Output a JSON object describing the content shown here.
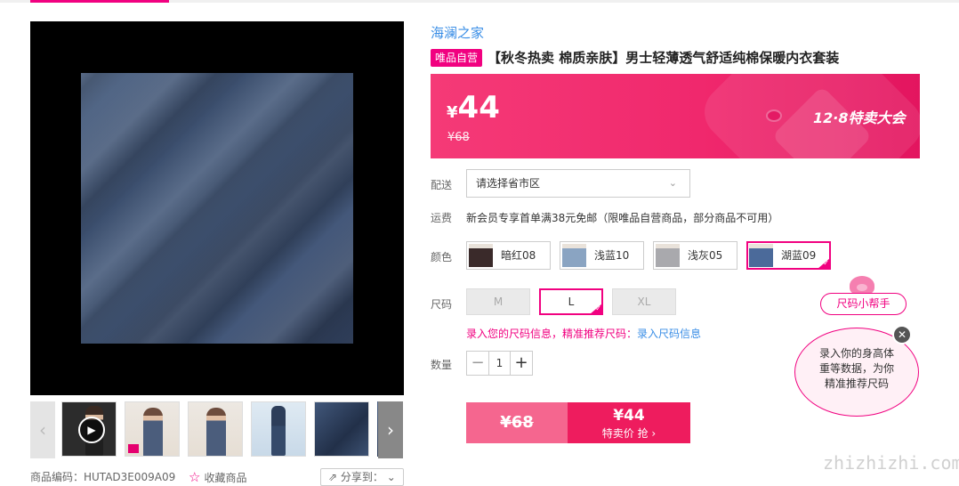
{
  "gallery": {
    "thumbnails": [
      "video",
      "model-front",
      "model-front-2",
      "model-full",
      "fabric",
      "fabric-detail"
    ]
  },
  "meta": {
    "product_code": "商品编码：HUTAD3E009A09",
    "favorite": "收藏商品",
    "share": "分享到："
  },
  "product": {
    "brand": "海澜之家",
    "vip_badge": "唯品自营",
    "title": "【秋冬热卖 棉质亲肤】男士轻薄透气舒适纯棉保暖内衣套装"
  },
  "price": {
    "currency": "¥",
    "current": "44",
    "original": "¥68",
    "promo": "12·8特卖大会"
  },
  "shipping": {
    "label": "配送",
    "select_value": "请选择省市区"
  },
  "freight": {
    "label": "运费",
    "text": "新会员专享首单满38元免邮（限唯品自营商品，部分商品不可用）"
  },
  "colors": {
    "label": "颜色",
    "options": [
      "暗红08",
      "浅蓝10",
      "浅灰05",
      "湖蓝09"
    ],
    "selected_index": 3
  },
  "sizes": {
    "label": "尺码",
    "options": [
      "M",
      "L",
      "XL"
    ],
    "selected_index": 1
  },
  "size_recommend": {
    "text": "录入您的尺码信息，精准推荐尺码：",
    "link": "录入尺码信息"
  },
  "quantity": {
    "label": "数量",
    "value": "1",
    "minus": "−",
    "plus": "+"
  },
  "buy": {
    "original_price": "¥68",
    "sale_price": "¥44",
    "sale_label": "特卖价 抢 ›"
  },
  "helper": {
    "button": "尺码小帮手",
    "bubble_line1": "录入你的身高体",
    "bubble_line2": "重等数据，为你",
    "bubble_line3": "精准推荐尺码"
  },
  "watermark": "zhizhizhi.com",
  "colors_theme": {
    "accent": "#f10180",
    "link": "#3a8ee6",
    "banner": "#f0286d"
  }
}
